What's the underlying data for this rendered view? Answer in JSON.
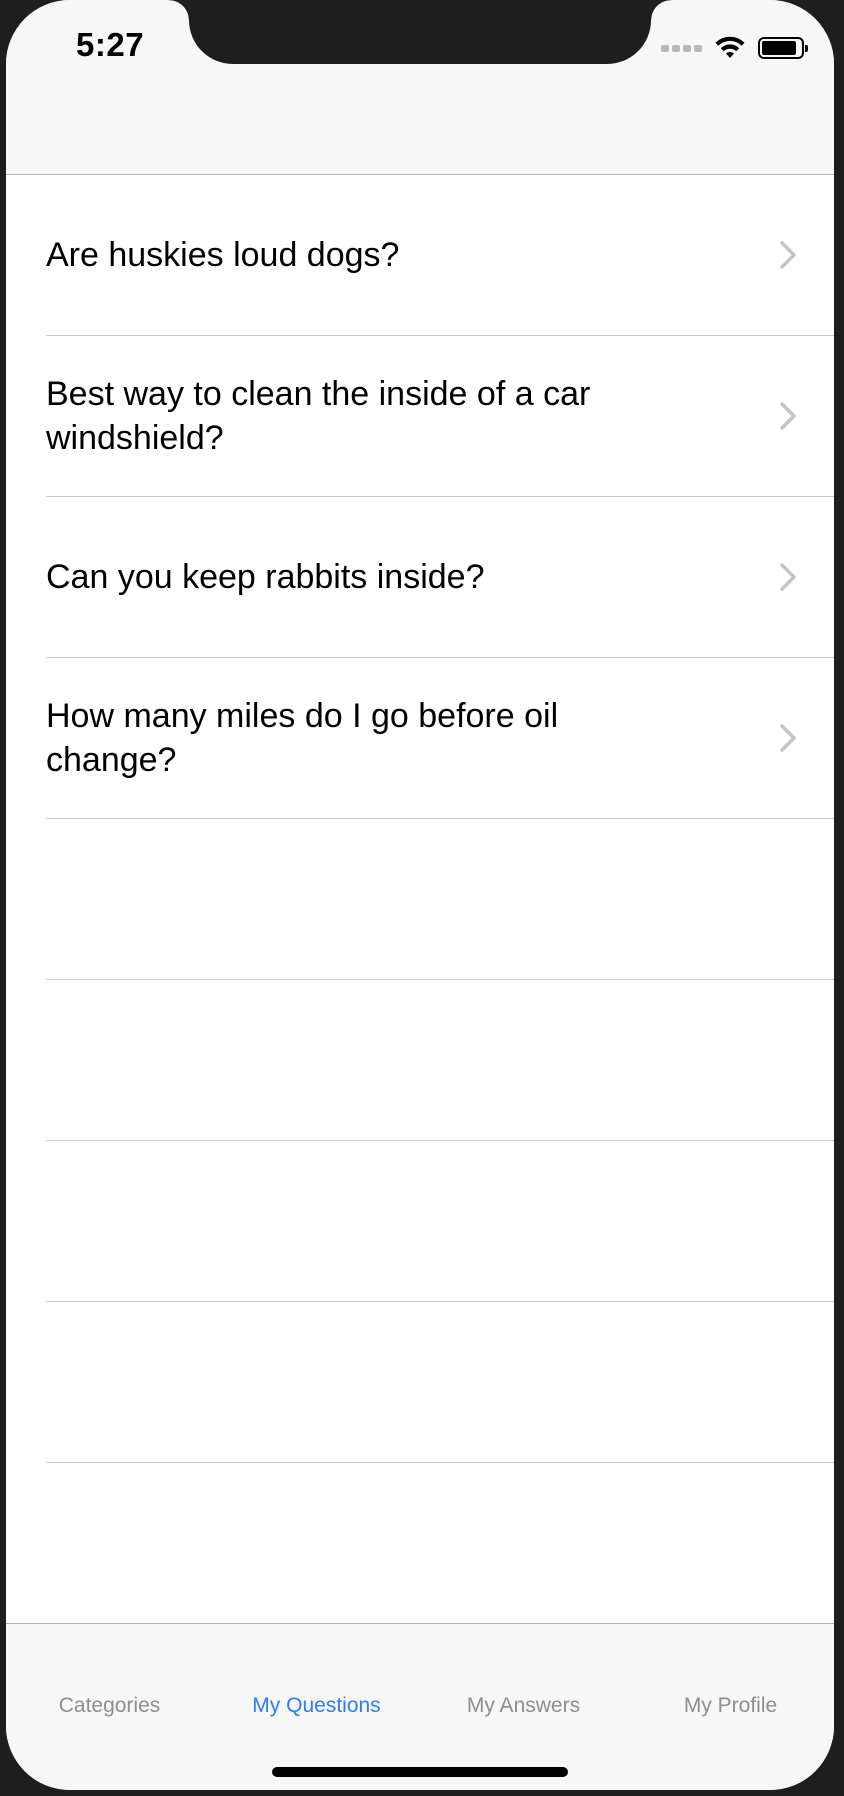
{
  "status_bar": {
    "time": "5:27",
    "icons": [
      "signal-icon",
      "wifi-icon",
      "battery-icon"
    ]
  },
  "questions": [
    {
      "label": "Are huskies loud dogs?"
    },
    {
      "label": "Best way to clean the inside of a car windshield?"
    },
    {
      "label": "Can you keep rabbits inside?"
    },
    {
      "label": "How many miles do I go before oil change?"
    }
  ],
  "tab_bar": {
    "tabs": [
      {
        "label": "Categories",
        "active": false
      },
      {
        "label": "My Questions",
        "active": true
      },
      {
        "label": "My Answers",
        "active": false
      },
      {
        "label": "My Profile",
        "active": false
      }
    ],
    "active_color": "#2f7cf6",
    "inactive_color": "#8e8e93"
  }
}
